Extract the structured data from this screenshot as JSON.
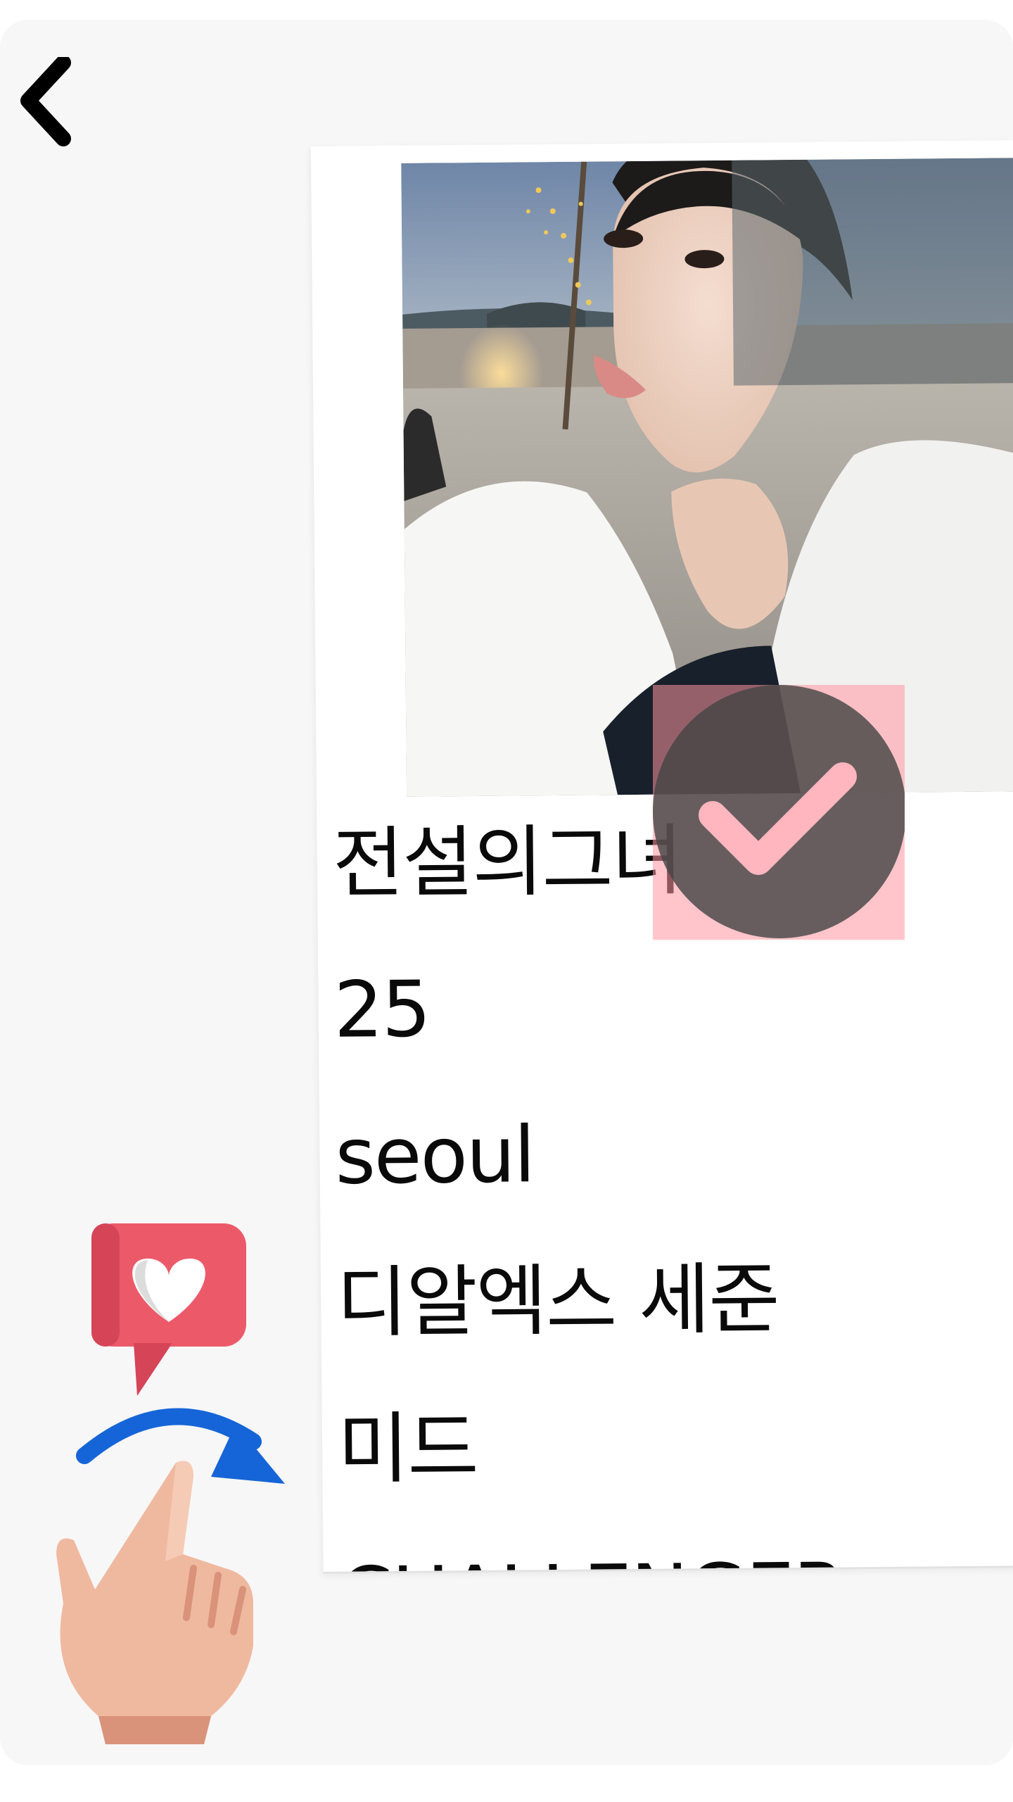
{
  "navigation": {
    "back_icon": "chevron-left-icon"
  },
  "profile": {
    "nickname": "전설의그녀",
    "age": "25",
    "location": "seoul",
    "team": "디알엑스 세준",
    "position": "미드",
    "tier": "CHALLENGER"
  },
  "overlay": {
    "check_icon": "checkmark-circle-icon",
    "tint_color": "#ff96a0"
  },
  "hint": {
    "bubble_icon": "heart-bubble-icon",
    "arrow_icon": "curved-arrow-right-icon",
    "hand_icon": "pointing-hand-icon",
    "bubble_color": "#ec5a6a",
    "arrow_color": "#1565d8"
  }
}
